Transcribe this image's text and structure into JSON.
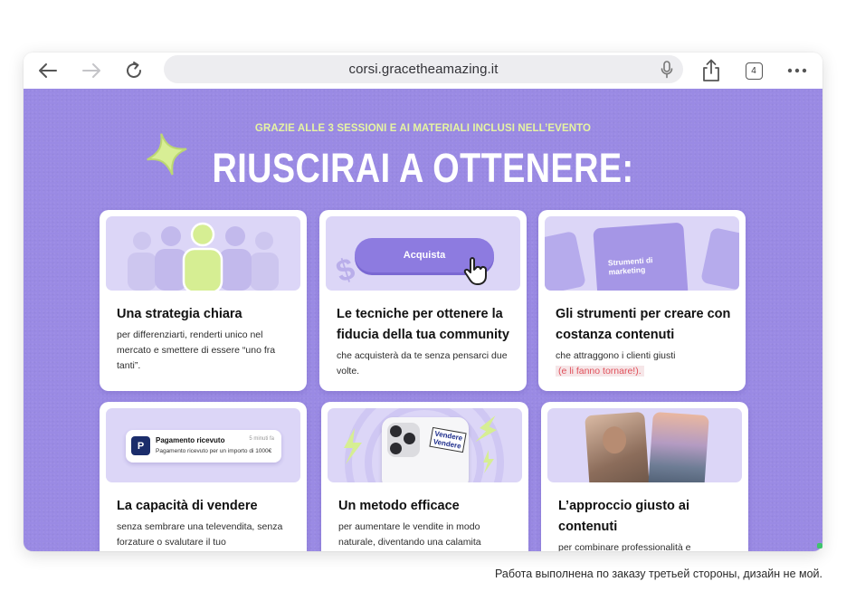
{
  "browser": {
    "url": "corsi.gracetheamazing.it",
    "tab_count": "4",
    "icons": [
      "back-arrow-icon",
      "forward-arrow-icon",
      "reload-icon",
      "microphone-icon",
      "share-icon",
      "tabs-icon",
      "more-icon"
    ]
  },
  "page": {
    "kicker": "GRAZIE ALLE 3 SESSIONI E AI MATERIALI INCLUSI NELL’EVENTO",
    "headline": "RIUSCIRAI A OTTENERE:",
    "accent": "#9a8ae4",
    "highlight": "#e6f4a2"
  },
  "cards": [
    {
      "title": "Una strategia chiara",
      "desc": "per differenziarti, renderti unico nel mercato e smettere di essere “uno fra tanti”."
    },
    {
      "title": "Le tecniche per ottenere la fiducia della tua community",
      "desc": "che acquisterà da te senza pensarci due volte.",
      "art_button": "Acquista"
    },
    {
      "title": "Gli strumenti per creare con costanza contenuti",
      "desc": "che attraggono i clienti giusti",
      "desc_highlight": "(e li fanno tornare!).",
      "art_label": "Strumenti di marketing"
    },
    {
      "title": "La capacità di vendere",
      "desc": "senza sembrare una televendita, senza forzature o svalutare il tuo",
      "notification": {
        "title": "Pagamento ricevuto",
        "time": "5 minuti fa",
        "body": "Pagamento ricevuto per un importo di 1000€"
      }
    },
    {
      "title": "Un metodo efficace",
      "desc": "per aumentare le vendite in modo naturale, diventando una calamita",
      "sticker": [
        "Vendere",
        "Vendere"
      ]
    },
    {
      "title": "L’approccio giusto ai contenuti",
      "desc": "per combinare professionalità e"
    }
  ],
  "caption": "Работа выполнена по заказу третьей стороны, дизайн не мой."
}
